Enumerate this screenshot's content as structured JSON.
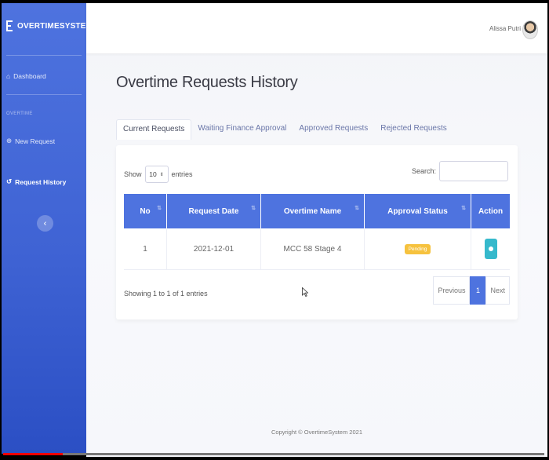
{
  "brand": "OVERTIMESYSTEM",
  "colors": {
    "primary": "#4e73df",
    "info": "#36b9cc",
    "warning": "#f6c23e"
  },
  "sidebar": {
    "dashboard": "Dashboard",
    "section": "OVERTIME",
    "new_request": "New Request",
    "history": "Request History",
    "toggle_icon": "chevron-left-icon"
  },
  "topbar": {
    "user": "Alissa Putri"
  },
  "page": {
    "title": "Overtime Requests History"
  },
  "tabs": [
    "Current Requests",
    "Waiting Finance Approval",
    "Approved Requests",
    "Rejected Requests"
  ],
  "table": {
    "show_label": "Show",
    "entries_value": "10",
    "entries_label": "entries",
    "search_label": "Search:",
    "headers": [
      "No",
      "Request Date",
      "Overtime Name",
      "Approval Status",
      "Action"
    ],
    "rows": [
      {
        "no": "1",
        "date": "2021-12-01",
        "name": "MCC 58 Stage 4",
        "status": "Pending"
      }
    ],
    "showing": "Showing 1 to 1 of 1 entries",
    "pager": {
      "prev": "Previous",
      "page": "1",
      "next": "Next"
    }
  },
  "footer": "Copyright © OvertimeSystem 2021",
  "video_progress": 0.11
}
